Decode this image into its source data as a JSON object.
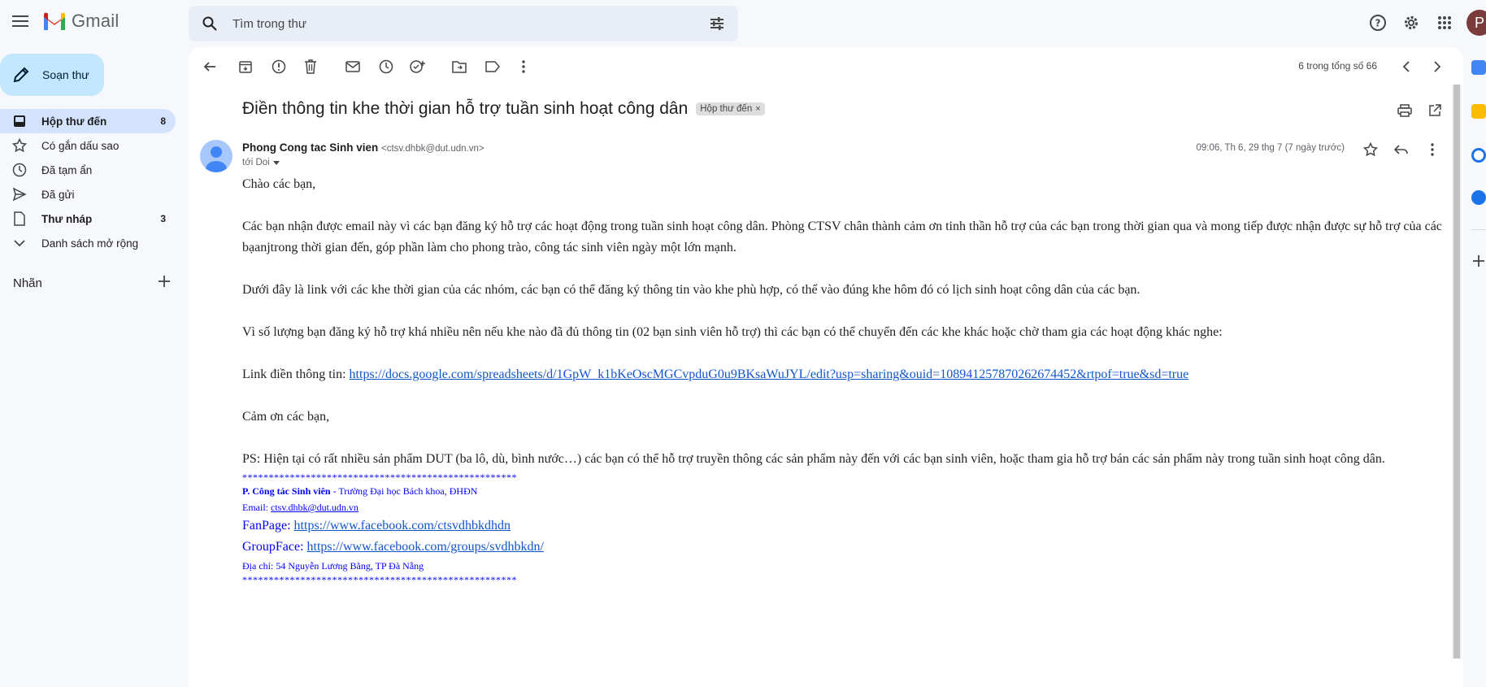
{
  "app": {
    "name": "Gmail"
  },
  "search": {
    "placeholder": "Tìm trong thư"
  },
  "sidebar": {
    "compose_label": "Soạn thư",
    "items": [
      {
        "label": "Hộp thư đến",
        "count": "8",
        "icon": "inbox-icon"
      },
      {
        "label": "Có gắn dấu sao",
        "count": "",
        "icon": "star-icon"
      },
      {
        "label": "Đã tạm ẩn",
        "count": "",
        "icon": "clock-icon"
      },
      {
        "label": "Đã gửi",
        "count": "",
        "icon": "send-icon"
      },
      {
        "label": "Thư nháp",
        "count": "3",
        "icon": "draft-icon"
      },
      {
        "label": "Danh sách mở rộng",
        "count": "",
        "icon": "chevron-down-icon"
      }
    ],
    "labels_title": "Nhãn"
  },
  "toolbar": {
    "pager": "6 trong tổng số 66"
  },
  "email": {
    "subject": "Điền thông tin khe thời gian hỗ trợ tuần sinh hoạt công dân",
    "chip": "Hộp thư đến",
    "chip_close": "×",
    "sender_name": "Phong Cong tac Sinh vien",
    "sender_email": "<ctsv.dhbk@dut.udn.vn>",
    "to": "tới Doi",
    "date": "09:06, Th 6, 29 thg 7 (7 ngày trước)",
    "greeting": "Chào các bạn,",
    "para1": "Các bạn nhận được email này vì các bạn đăng ký hỗ trợ các hoạt động trong tuần sinh hoạt công dân. Phòng CTSV chân thành cảm ơn tinh thần hỗ trợ của các bạn trong thời gian qua và mong tiếp được nhận được sự hỗ trợ của các bạanjtrong thời gian đến, góp phần làm cho phong trào, công tác sinh viên ngày một lớn mạnh.",
    "para2": "Dưới đây là link với các khe thời gian của các nhóm, các bạn có thể đăng ký thông tin vào khe phù hợp, có thể vào đúng khe hôm đó có lịch sinh hoạt công dân của các bạn.",
    "para3": "Vì số lượng bạn đăng ký hỗ trợ khá nhiều nên nếu khe nào đã đủ thông tin (02 bạn sinh viên hỗ trợ) thì các bạn có thể chuyển đến các khe khác hoặc chờ tham gia các hoạt động khác nghe:",
    "link_label": "Link điền thông tin: ",
    "link_url": "https://docs.google.com/spreadsheets/d/1GpW_k1bKeOscMGCvpduG0u9BKsaWuJYL/edit?usp=sharing&ouid=108941257870262674452&rtpof=true&sd=true",
    "thanks": "Cảm ơn các bạn,",
    "ps": "PS: Hiện tại có rất nhiều sản phẩm DUT (ba lô, dù, bình nước…) các bạn có thể hỗ trợ truyền thông các sản phẩm này đến với các bạn sinh viên, hoặc tham gia hỗ trợ bán các sản phẩm này trong tuần sinh hoạt công dân.",
    "sig_stars": "****************************************************",
    "sig_org_bold": "P. Công tác Sinh viên",
    "sig_org_rest": " - Trường Đại học Bách khoa, ĐHĐN",
    "sig_email_label": "Email: ",
    "sig_email": "ctsv.dhbk@dut.udn.vn",
    "sig_fanpage_label": "FanPage: ",
    "sig_fanpage": "https://www.facebook.com/ctsvdhbkdhdn",
    "sig_group_label": "GroupFace: ",
    "sig_group": "https://www.facebook.com/groups/svdhbkdn/",
    "sig_address": "Địa chỉ: 54 Nguyễn Lương Bằng, TP Đà Nẵng"
  },
  "user": {
    "avatar_letter": "P"
  },
  "colors": {
    "accent": "#c2e7ff",
    "active_nav": "#d3e3fd",
    "link": "#1155cc",
    "signature": "#0000ff"
  }
}
